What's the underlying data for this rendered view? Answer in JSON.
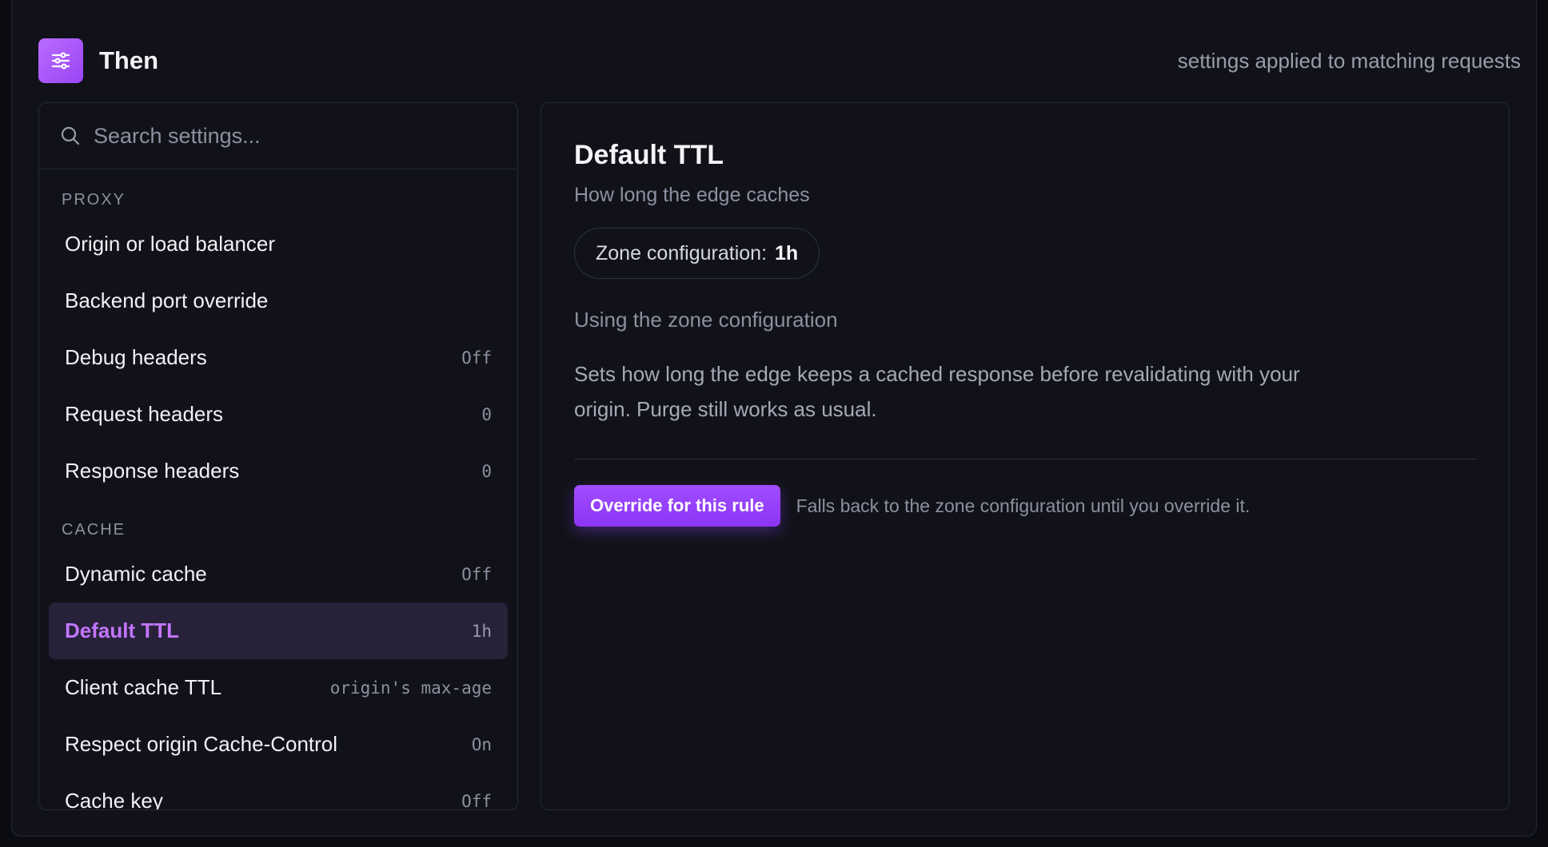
{
  "header": {
    "title": "Then",
    "note": "settings applied to matching requests",
    "icon": "sliders-icon"
  },
  "sidebar": {
    "search_placeholder": "Search settings...",
    "groups": [
      {
        "label": "PROXY",
        "items": [
          {
            "label": "Origin or load balancer",
            "value": ""
          },
          {
            "label": "Backend port override",
            "value": ""
          },
          {
            "label": "Debug headers",
            "value": "Off"
          },
          {
            "label": "Request headers",
            "value": "0"
          },
          {
            "label": "Response headers",
            "value": "0"
          }
        ]
      },
      {
        "label": "CACHE",
        "items": [
          {
            "label": "Dynamic cache",
            "value": "Off"
          },
          {
            "label": "Default TTL",
            "value": "1h",
            "active": true
          },
          {
            "label": "Client cache TTL",
            "value": "origin's max-age"
          },
          {
            "label": "Respect origin Cache-Control",
            "value": "On"
          },
          {
            "label": "Cache key",
            "value": "Off"
          }
        ]
      }
    ]
  },
  "detail": {
    "title": "Default TTL",
    "subtitle": "How long the edge caches",
    "zone_label": "Zone configuration:",
    "zone_value": "1h",
    "status": "Using the zone configuration",
    "description": "Sets how long the edge keeps a cached response before revalidating with your origin. Purge still works as usual.",
    "override_button": "Override for this rule",
    "fallback_note": "Falls back to the zone configuration until you override it."
  },
  "colors": {
    "accent": "#9b45f5",
    "active_text": "#c376ff",
    "background": "#111219"
  }
}
